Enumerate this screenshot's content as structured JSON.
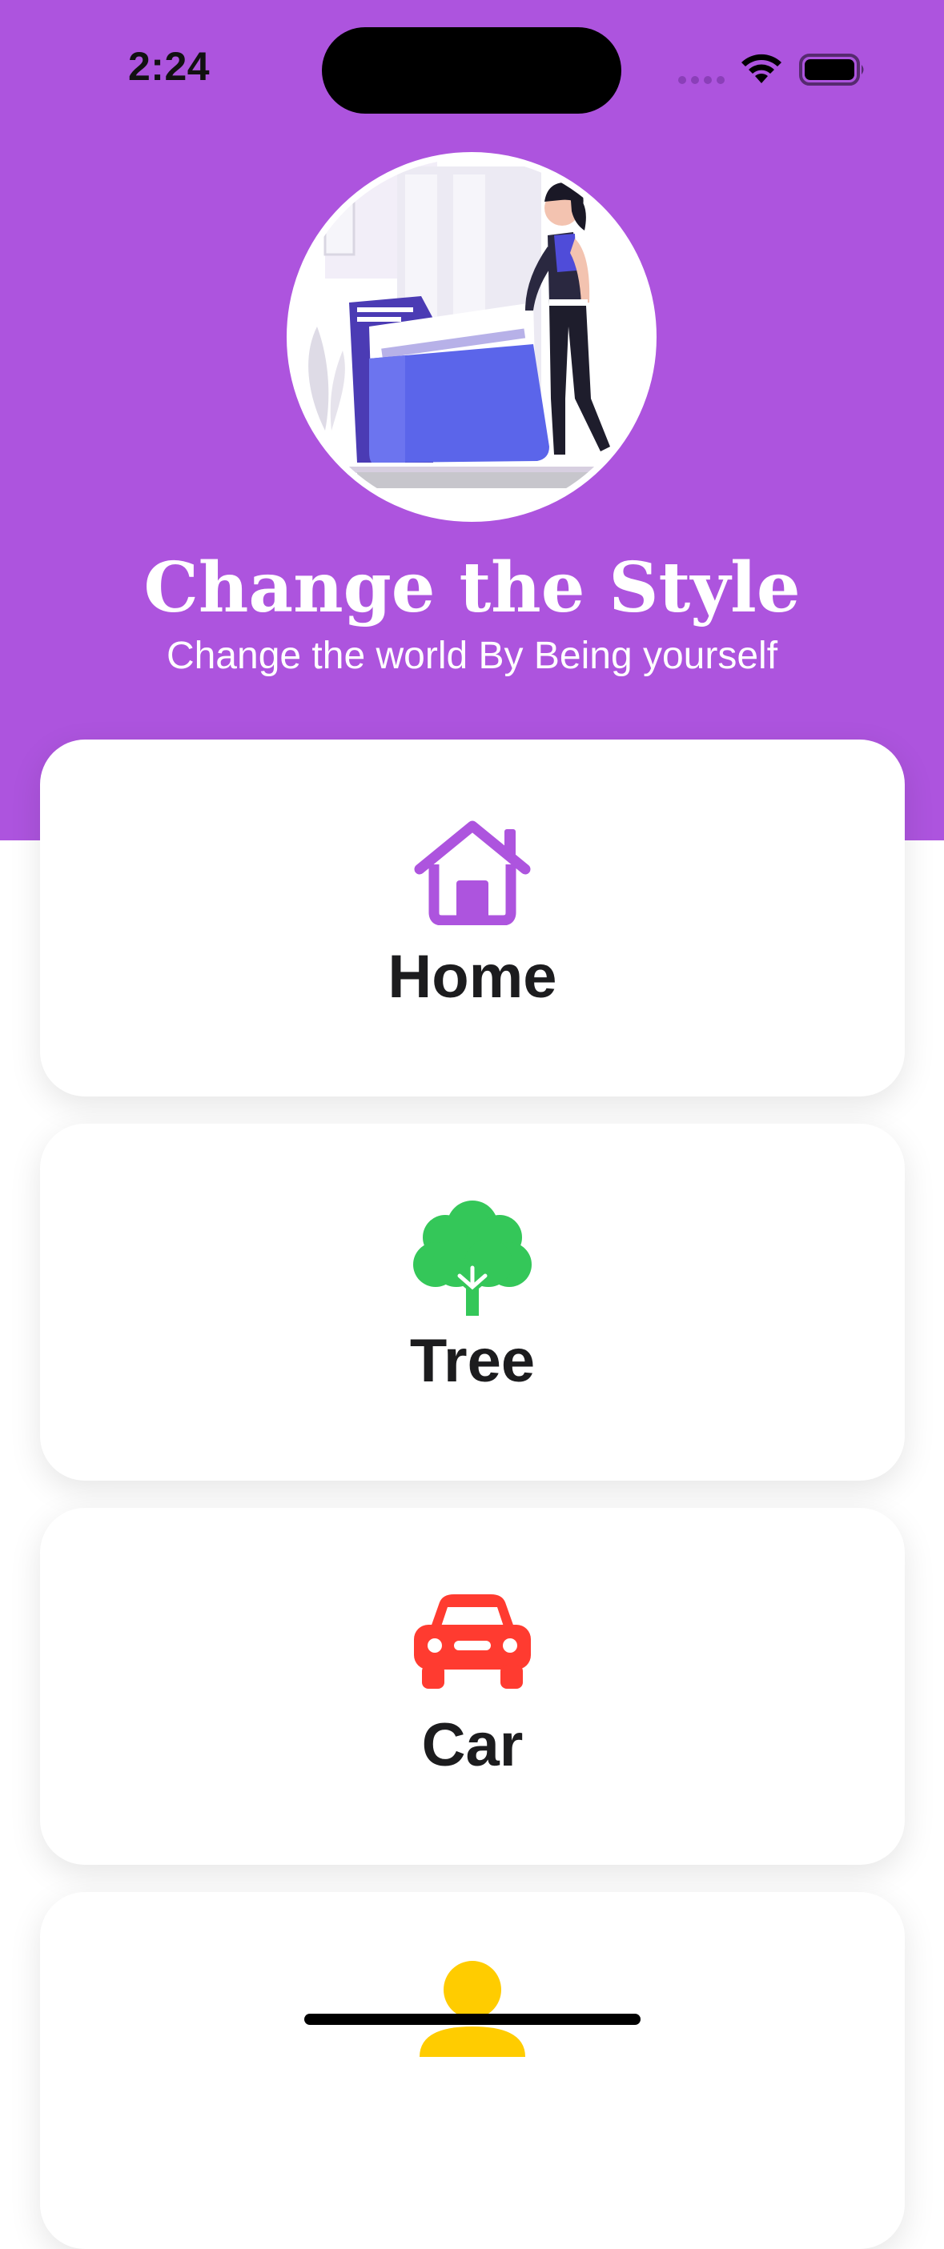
{
  "status_bar": {
    "time": "2:24"
  },
  "hero": {
    "image_icon": "person-with-folders-illustration",
    "title": "Change the Style",
    "subtitle": "Change the world By Being yourself"
  },
  "cards": [
    {
      "label": "Home",
      "icon": "house-icon",
      "icon_color": "#AD54DE"
    },
    {
      "label": "Tree",
      "icon": "tree-icon",
      "icon_color": "#34C759"
    },
    {
      "label": "Car",
      "icon": "car-icon",
      "icon_color": "#FF3B30"
    },
    {
      "label": "",
      "icon": "person-icon",
      "icon_color": "#FFCC00"
    }
  ],
  "colors": {
    "header_background": "#AD54DE",
    "card_background": "#FFFFFF"
  }
}
